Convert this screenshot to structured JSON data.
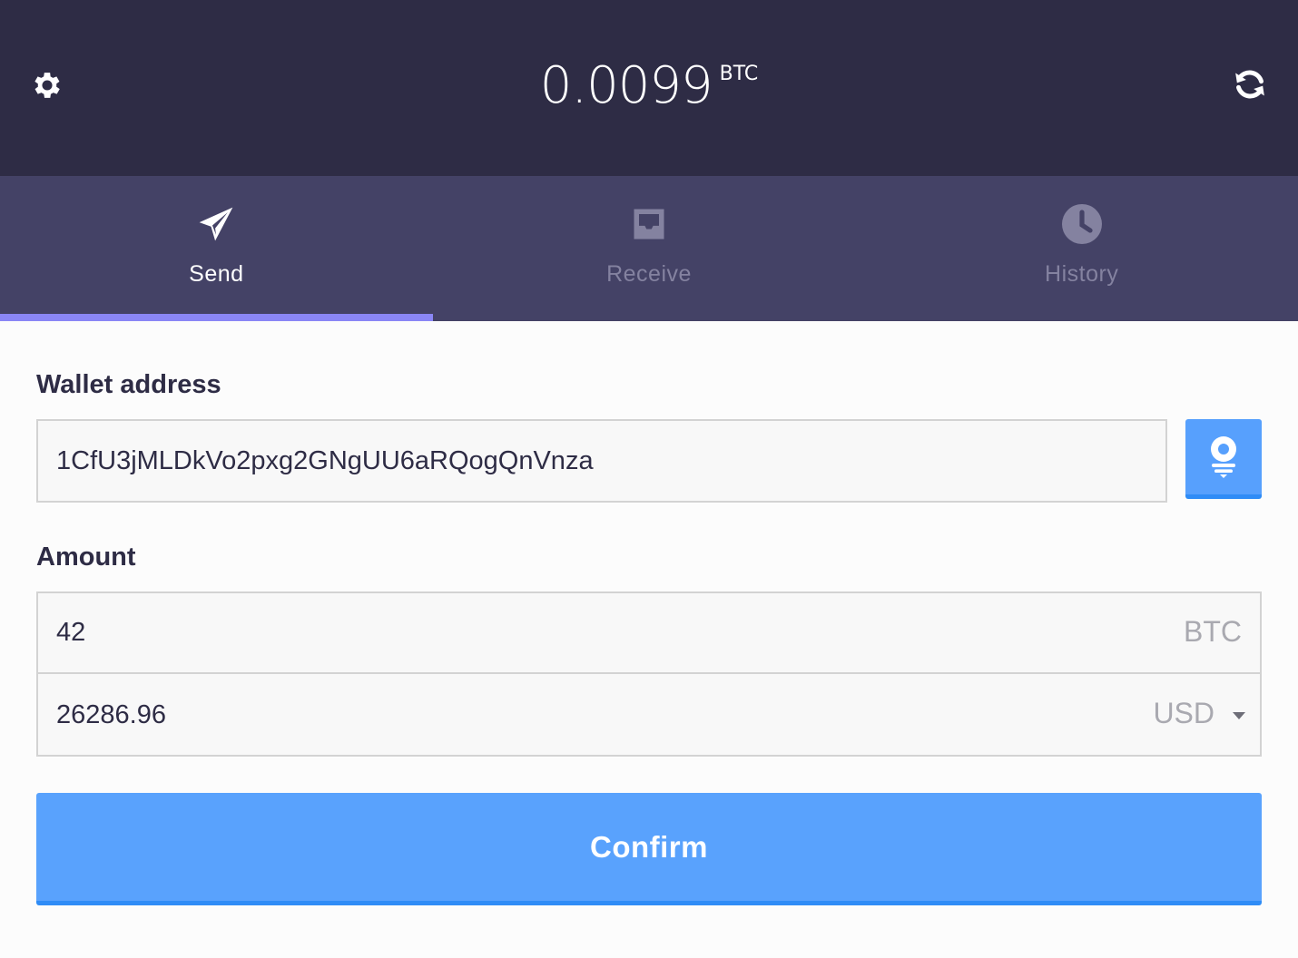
{
  "header": {
    "balance_amount": "0.0099",
    "balance_unit": "BTC",
    "settings_icon": "gear-icon",
    "refresh_icon": "refresh-icon",
    "background_color": "#2e2c45"
  },
  "tabs": [
    {
      "label": "Send",
      "icon": "paper-plane-icon",
      "active": true
    },
    {
      "label": "Receive",
      "icon": "inbox-icon",
      "active": false
    },
    {
      "label": "History",
      "icon": "clock-icon",
      "active": false
    }
  ],
  "form": {
    "wallet_label": "Wallet address",
    "wallet_value": "1CfU3jMLDkVo2pxg2GNgUU6aRQogQnVnza",
    "scan_icon": "scan-pin-icon",
    "amount_label": "Amount",
    "amount_btc_value": "42",
    "amount_btc_unit": "BTC",
    "amount_fiat_value": "26286.96",
    "amount_fiat_currency": "USD",
    "confirm_label": "Confirm"
  },
  "colors": {
    "tab_bar": "#444266",
    "active_indicator": "#8a86f5",
    "primary_button": "#59a2fd"
  }
}
